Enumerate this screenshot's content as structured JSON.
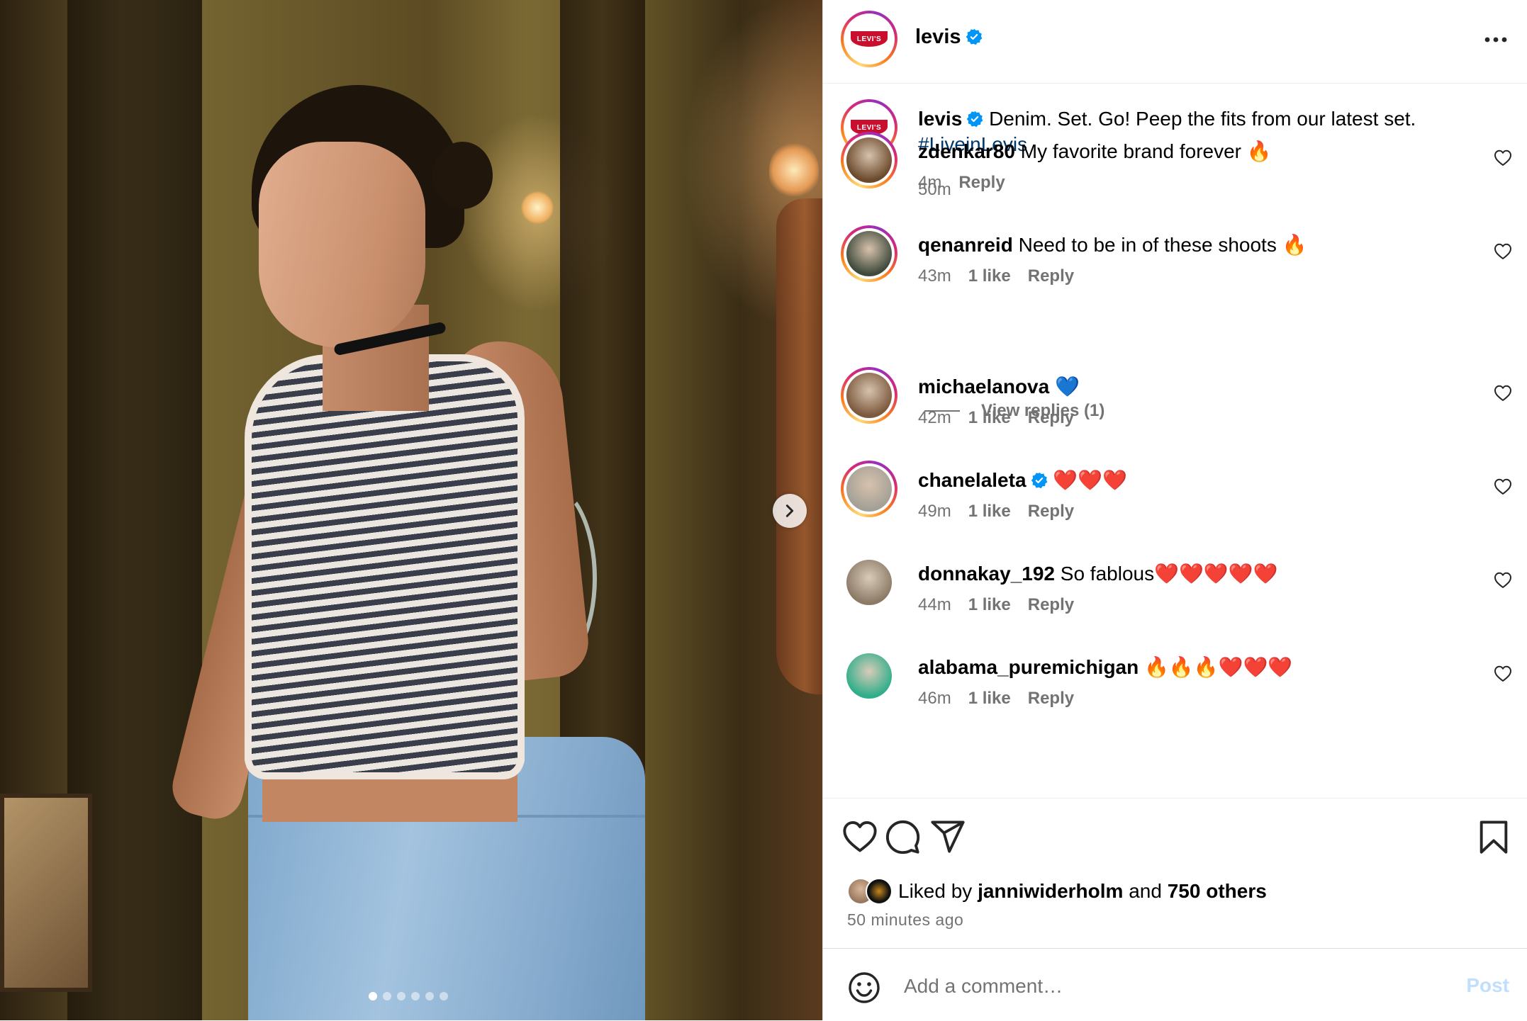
{
  "post": {
    "username": "levis",
    "verified": true,
    "logo_text": "LEVI'S",
    "carousel": {
      "slides": 6,
      "active_index": 0
    }
  },
  "caption": {
    "username": "levis",
    "text": "Denim. Set. Go! Peep the fits from our latest set.",
    "hashtag": "#LiveinLevis",
    "time": "50m"
  },
  "comments": [
    {
      "username": "zdenkar80",
      "verified": false,
      "text": "My favorite brand forever 🔥",
      "time": "4m",
      "likes": "",
      "reply": "Reply",
      "avatar_color": "#6b4a2c",
      "ring": true
    },
    {
      "username": "qenanreid",
      "verified": false,
      "text": "Need to be in of these shoots 🔥",
      "time": "43m",
      "likes": "1 like",
      "reply": "Reply",
      "avatar_color": "#3f4a3c",
      "ring": true
    },
    {
      "username": "michaelanova",
      "verified": false,
      "text": "💙",
      "time": "42m",
      "likes": "1 like",
      "reply": "Reply",
      "avatar_color": "#7c5a3e",
      "ring": true
    },
    {
      "username": "chanelaleta",
      "verified": true,
      "text": "❤️❤️❤️",
      "time": "49m",
      "likes": "1 like",
      "reply": "Reply",
      "avatar_color": "#a4a096",
      "ring": true
    },
    {
      "username": "donnakay_192",
      "verified": false,
      "text": "So fablous❤️❤️❤️❤️❤️",
      "time": "44m",
      "likes": "1 like",
      "reply": "Reply",
      "avatar_color": "#8b7a66",
      "ring": false
    },
    {
      "username": "alabama_puremichigan",
      "verified": false,
      "text": "🔥🔥🔥❤️❤️❤️",
      "time": "46m",
      "likes": "1 like",
      "reply": "Reply",
      "avatar_color": "#2fae8a",
      "ring": false
    }
  ],
  "view_replies": "View replies (1)",
  "likes": {
    "prefix": "Liked by",
    "user": "janniwiderholm",
    "middle": "and",
    "others": "750 others"
  },
  "time_ago": "50 minutes ago",
  "add_comment": {
    "placeholder": "Add a comment…",
    "post_label": "Post"
  },
  "colors": {
    "link": "#00376b",
    "verified": "#0095f6",
    "secondary": "#737373",
    "post_disabled": "#c0dffd",
    "levis_red": "#c8102e"
  },
  "icons": [
    "verified-badge-icon",
    "more-options-icon",
    "heart-icon",
    "comment-icon",
    "share-icon",
    "bookmark-icon",
    "emoji-icon",
    "chevron-right-icon"
  ]
}
